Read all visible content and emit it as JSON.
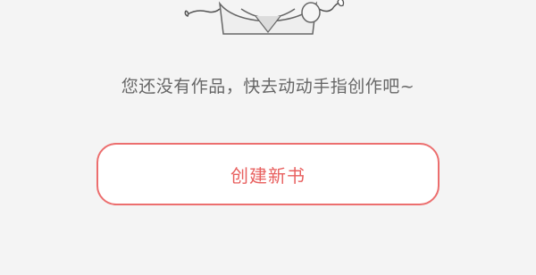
{
  "empty_state": {
    "illustration_icon": "cartoon-character-icon",
    "message": "您还没有作品，快去动动手指创作吧~"
  },
  "create_button": {
    "label": "创建新书"
  },
  "colors": {
    "background": "#f4f4f4",
    "message_text": "#666666",
    "accent": "#e8605f",
    "button_border": "#ec6e6e",
    "button_fill": "#ffffff"
  }
}
